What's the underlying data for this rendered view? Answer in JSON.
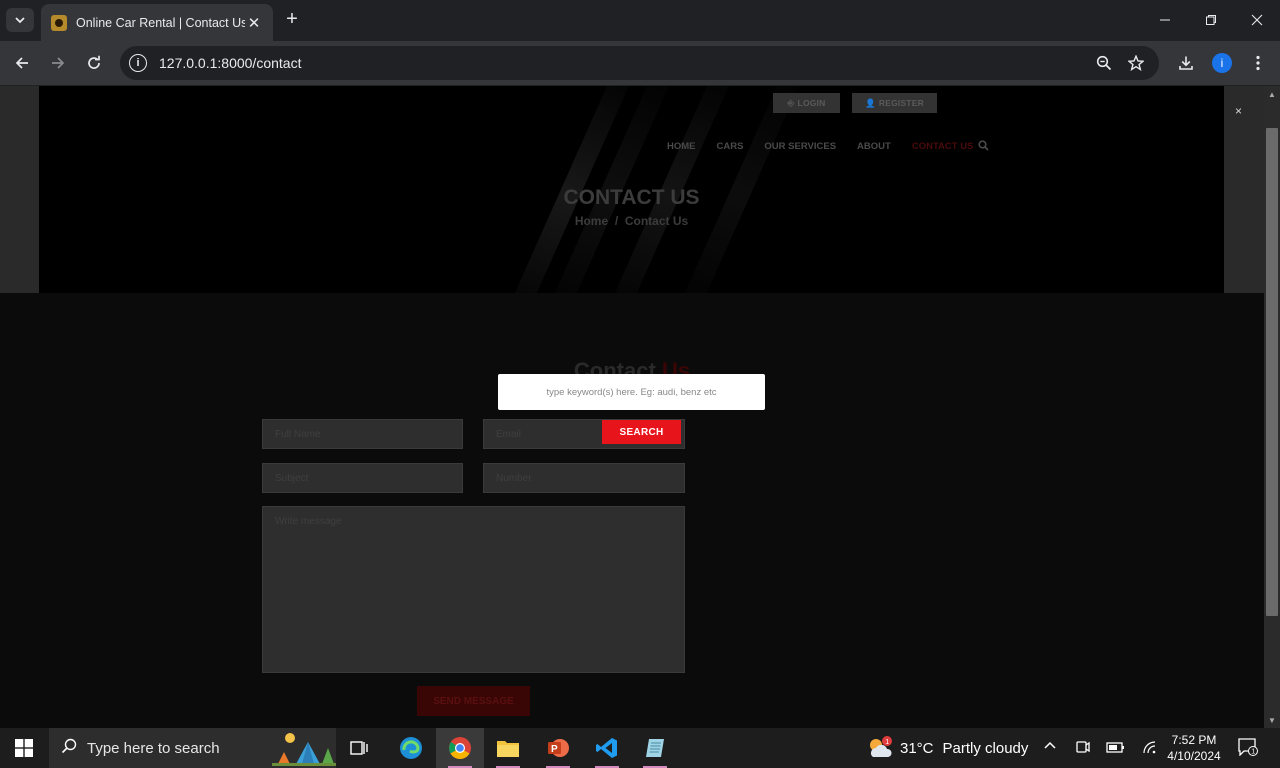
{
  "browser": {
    "tab_title": "Online Car Rental | Contact Us",
    "url_host": "127.0.0.1",
    "url_rest": ":8000/contact",
    "profile_initial": "i"
  },
  "site": {
    "login_label": "LOGIN",
    "register_label": "REGISTER",
    "nav": [
      "HOME",
      "CARS",
      "OUR SERVICES",
      "ABOUT",
      "CONTACT US"
    ],
    "hero_title": "CONTACT US",
    "breadcrumb_home": "Home",
    "breadcrumb_sep": "/",
    "breadcrumb_current": "Contact Us",
    "section_title_main": "Contact",
    "section_title_accent": "Us",
    "form": {
      "fullname_placeholder": "Full Name",
      "email_placeholder": "Email",
      "subject_placeholder": "Subject",
      "number_placeholder": "Number",
      "message_placeholder": "Write message",
      "send_label": "SEND MESSAGE"
    },
    "search_overlay": {
      "placeholder": "type keyword(s) here. Eg: audi, benz etc",
      "button_label": "SEARCH",
      "close_label": "×"
    }
  },
  "taskbar": {
    "search_placeholder": "Type here to search",
    "weather_temp": "31°C",
    "weather_desc": "Partly cloudy",
    "weather_badge": "1",
    "time": "7:52 PM",
    "date": "4/10/2024",
    "notification_count": "1"
  }
}
